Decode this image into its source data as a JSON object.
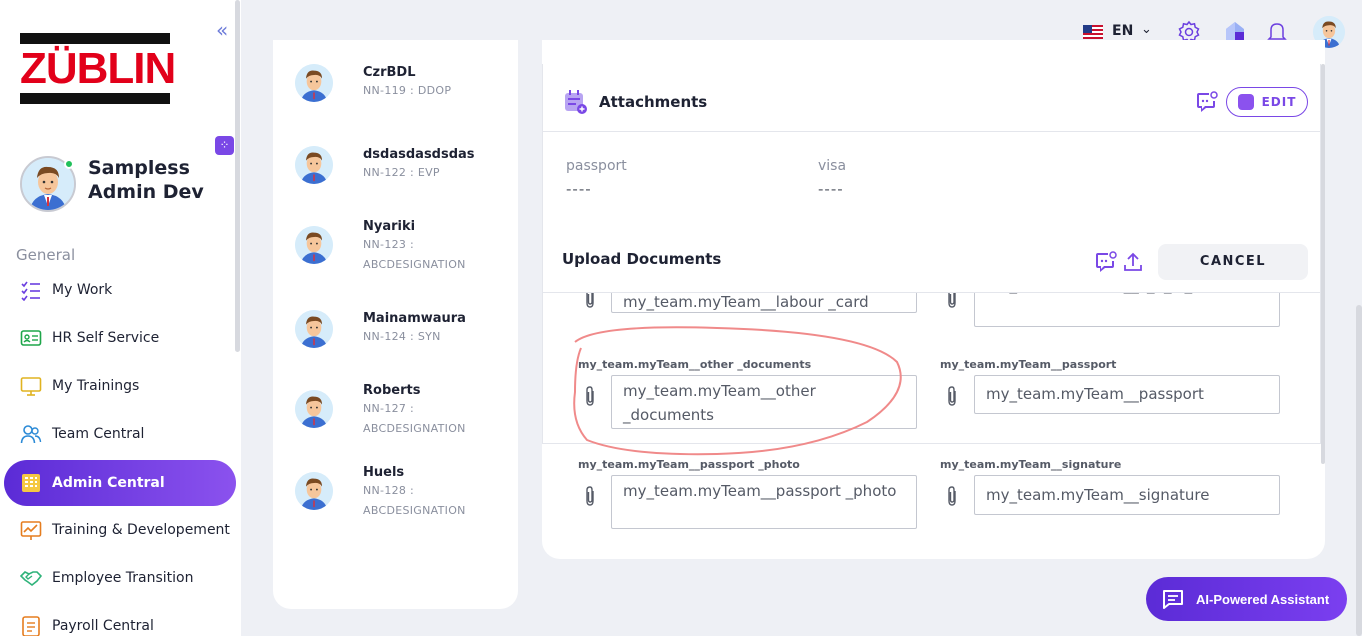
{
  "sidebar": {
    "logo_text": "ZÜBLIN",
    "user_name": "Sampless Admin Dev",
    "section_label": "General",
    "items": [
      {
        "label": "My Work",
        "icon": "checklist-icon"
      },
      {
        "label": "HR Self Service",
        "icon": "id-card-icon"
      },
      {
        "label": "My Trainings",
        "icon": "monitor-icon"
      },
      {
        "label": "Team Central",
        "icon": "team-icon"
      },
      {
        "label": "Admin Central",
        "icon": "building-icon",
        "active": true
      },
      {
        "label": "Training & Developement",
        "icon": "chart-icon"
      },
      {
        "label": "Employee Transition",
        "icon": "handshake-icon"
      },
      {
        "label": "Payroll Central",
        "icon": "payroll-icon"
      }
    ]
  },
  "topbar": {
    "language": "EN",
    "icons": [
      "flag-us-icon",
      "settings-icon",
      "home-icon",
      "bell-icon",
      "avatar"
    ]
  },
  "employees": [
    {
      "name": "CzrBDL",
      "sub": "NN-119 : DDOP"
    },
    {
      "name": "dsdasdasdsdas",
      "sub": "NN-122 : EVP"
    },
    {
      "name": "Nyariki",
      "sub": "NN-123 : ABCDESIGNATION"
    },
    {
      "name": "Mainamwaura",
      "sub": "NN-124 : SYN"
    },
    {
      "name": "Roberts",
      "sub": "NN-127 : ABCDESIGNATION"
    },
    {
      "name": "Huels",
      "sub": "NN-128 : ABCDESIGNATION"
    }
  ],
  "attachments": {
    "title": "Attachments",
    "edit_label": "EDIT",
    "fields": [
      {
        "label": "passport",
        "value": "----"
      },
      {
        "label": "visa",
        "value": "----"
      }
    ]
  },
  "upload": {
    "title": "Upload Documents",
    "cancel_label": "CANCEL",
    "fields": [
      {
        "label": "",
        "value": "my_team.myTeam__labour _card"
      },
      {
        "label": "",
        "value": "my_team.myTeam__c_n_c _document"
      },
      {
        "label": "my_team.myTeam__other _documents",
        "value": "my_team.myTeam__other _documents"
      },
      {
        "label": "my_team.myTeam__passport",
        "value": "my_team.myTeam__passport"
      },
      {
        "label": "my_team.myTeam__passport _photo",
        "value": "my_team.myTeam__passport _photo"
      },
      {
        "label": "my_team.myTeam__signature",
        "value": "my_team.myTeam__signature"
      }
    ]
  },
  "assistant": {
    "label": "AI-Powered Assistant"
  },
  "colors": {
    "accent": "#7a48e6",
    "brand": "#e2001a",
    "annotation": "#f08a8a"
  }
}
